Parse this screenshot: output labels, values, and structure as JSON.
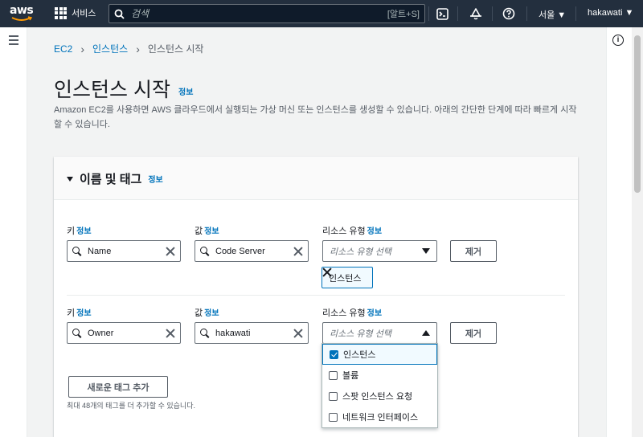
{
  "topbar": {
    "logo": "aws",
    "services_label": "서비스",
    "search_placeholder": "검색",
    "search_shortcut": "[알트+S]",
    "icons": [
      "search-icon",
      "terminal-icon",
      "bell-icon",
      "help-icon"
    ],
    "region": "서울 ▼",
    "user": "hakawati ▼"
  },
  "breadcrumb": {
    "root": "EC2",
    "parent": "인스턴스",
    "current": "인스턴스 시작"
  },
  "page": {
    "title": "인스턴스 시작",
    "title_info": "정보",
    "description": "Amazon EC2를 사용하면 AWS 클라우드에서 실행되는 가상 머신 또는 인스턴스를 생성할 수 있습니다. 아래의 간단한 단계에 따라 빠르게 시작할 수 있습니다."
  },
  "panel": {
    "title": "이름 및 태그",
    "info": "정보",
    "tags": [
      {
        "key_label": "키",
        "key_info": "정보",
        "key_value": "Name",
        "value_label": "값",
        "value_info": "정보",
        "value_value": "Code Server",
        "resource_label": "리소스 유형",
        "resource_info": "정보",
        "resource_placeholder": "리소스 유형 선택",
        "remove_label": "제거",
        "selected_token": "인스턴스"
      },
      {
        "key_label": "키",
        "key_info": "정보",
        "key_value": "Owner",
        "value_label": "값",
        "value_info": "정보",
        "value_value": "hakawati",
        "resource_label": "리소스 유형",
        "resource_info": "정보",
        "resource_placeholder": "리소스 유형 선택",
        "remove_label": "제거"
      }
    ],
    "dropdown_options": [
      {
        "label": "인스턴스",
        "checked": true
      },
      {
        "label": "볼륨",
        "checked": false
      },
      {
        "label": "스팟 인스턴스 요청",
        "checked": false
      },
      {
        "label": "네트워크 인터페이스",
        "checked": false
      }
    ],
    "add_tag_label": "새로운 태그 추가",
    "add_tag_hint": "최대 48개의 태그를 더 추가할 수 있습니다."
  },
  "colors": {
    "nav_bg": "#232f3e",
    "link": "#0073bb",
    "aws_orange": "#ff9900"
  }
}
